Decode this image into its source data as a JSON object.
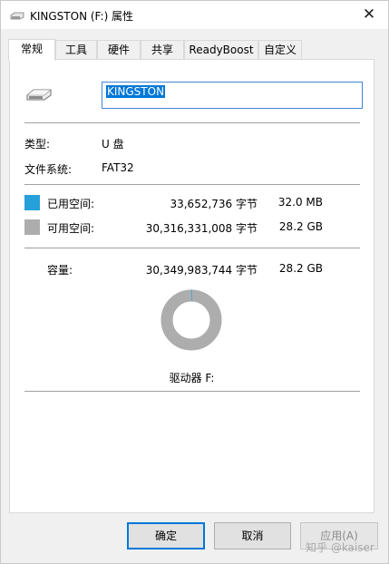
{
  "window": {
    "title": "KINGSTON (F:) 属性",
    "close_glyph": "✕"
  },
  "tabs": [
    {
      "label": "常规"
    },
    {
      "label": "工具"
    },
    {
      "label": "硬件"
    },
    {
      "label": "共享"
    },
    {
      "label": "ReadyBoost"
    },
    {
      "label": "自定义"
    }
  ],
  "general": {
    "volume_name": "KINGSTON",
    "type_label": "类型:",
    "type_value": "U 盘",
    "fs_label": "文件系统:",
    "fs_value": "FAT32",
    "used_label": "已用空间:",
    "used_bytes": "33,652,736 字节",
    "used_size": "32.0 MB",
    "free_label": "可用空间:",
    "free_bytes": "30,316,331,008 字节",
    "free_size": "28.2 GB",
    "capacity_label": "容量:",
    "capacity_bytes": "30,349,983,744 字节",
    "capacity_size": "28.2 GB",
    "drive_label": "驱动器 F:",
    "used_color": "#26a0da",
    "free_color": "#adadad"
  },
  "usage_chart": {
    "used_fraction": 0.0011
  },
  "buttons": {
    "ok": "确定",
    "cancel": "取消",
    "apply": "应用(A)"
  },
  "watermark": "知乎 @kaiser"
}
